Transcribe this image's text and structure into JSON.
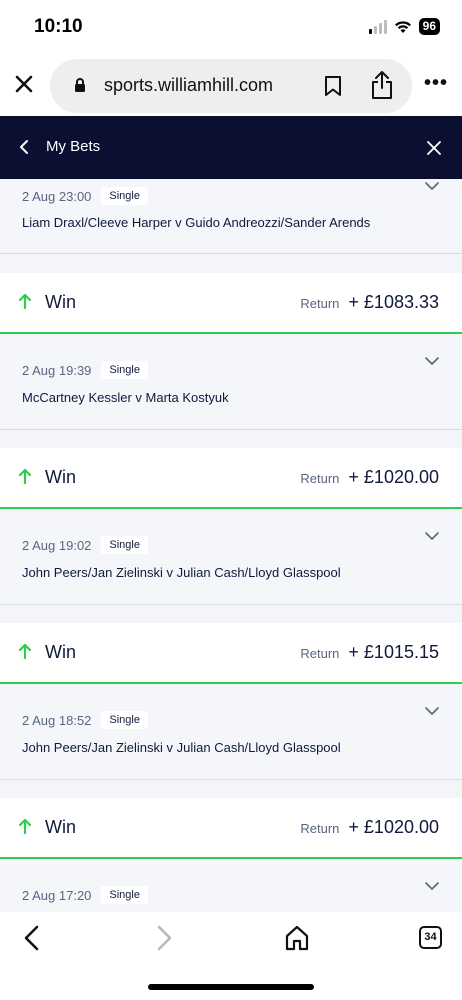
{
  "status_bar": {
    "time": "10:10",
    "battery": "96"
  },
  "browser": {
    "url": "sports.williamhill.com",
    "tabs_count": "34",
    "icons": [
      "close-icon",
      "lock-icon",
      "bookmark-icon",
      "share-icon",
      "more-icon",
      "back-icon",
      "forward-icon",
      "home-icon",
      "tabs-icon"
    ]
  },
  "header": {
    "title": "My Bets"
  },
  "colors": {
    "header_bg": "#0b1033",
    "win_green": "#2ecc4f",
    "text_navy": "#101a3d"
  },
  "bets": [
    {
      "date": "2 Aug 23:00",
      "type": "Single",
      "match": "Liam Draxl/Cleeve Harper v Guido Andreozzi/Sander Arends",
      "result": "Win",
      "return_label": "Return",
      "return_amount": "+ £1083.33"
    },
    {
      "date": "2 Aug 19:39",
      "type": "Single",
      "match": "McCartney Kessler v Marta Kostyuk",
      "result": "Win",
      "return_label": "Return",
      "return_amount": "+ £1020.00"
    },
    {
      "date": "2 Aug 19:02",
      "type": "Single",
      "match": "John Peers/Jan Zielinski v Julian Cash/Lloyd Glasspool",
      "result": "Win",
      "return_label": "Return",
      "return_amount": "+ £1015.15"
    },
    {
      "date": "2 Aug 18:52",
      "type": "Single",
      "match": "John Peers/Jan Zielinski v Julian Cash/Lloyd Glasspool",
      "result": "Win",
      "return_label": "Return",
      "return_amount": "+ £1020.00"
    },
    {
      "date": "2 Aug 17:20",
      "type": "Single"
    }
  ]
}
